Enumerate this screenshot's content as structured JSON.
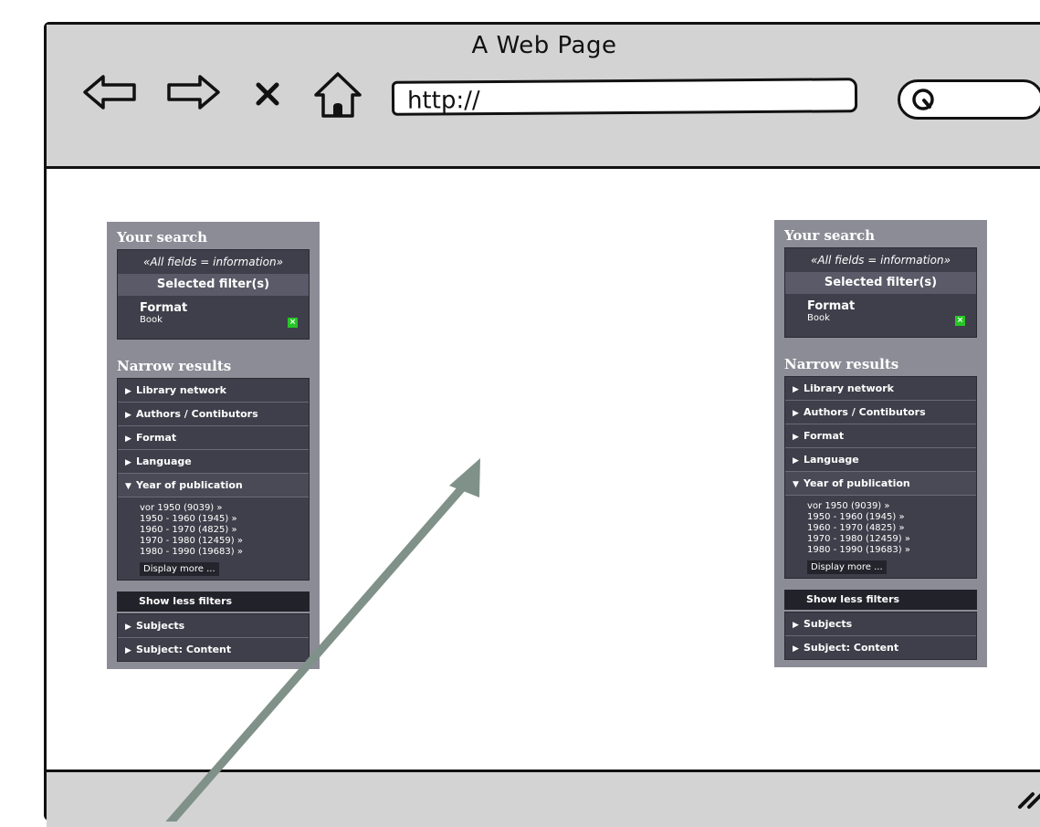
{
  "browser": {
    "title": "A Web Page",
    "url": "http://",
    "back_icon": "back-arrow-icon",
    "forward_icon": "forward-arrow-icon",
    "stop_icon": "close-icon",
    "home_icon": "home-icon",
    "search_icon": "search-icon",
    "resize_icon": "resize-grip-icon"
  },
  "panels": [
    {
      "your_search": "Your search",
      "query": "«All fields = information»",
      "selected_filters": "Selected filter(s)",
      "filter": {
        "name": "Format",
        "value": "Book",
        "remove": "×"
      },
      "narrow_results": "Narrow results",
      "facets": [
        "Library network",
        "Authors / Contibutors",
        "Format",
        "Language"
      ],
      "open_facet": "Year of publication",
      "years": [
        "vor 1950  (9039) »",
        "1950 - 1960  (1945) »",
        "1960 - 1970  (4825) »",
        "1970 - 1980  (12459) »",
        "1980 - 1990  (19683) »"
      ],
      "display_more": "Display more ...",
      "show_less": "Show less filters",
      "more_facets": [
        "Subjects",
        "Subject: Content"
      ]
    },
    {
      "your_search": "Your search",
      "query": "«All fields = information»",
      "selected_filters": "Selected filter(s)",
      "filter": {
        "name": "Format",
        "value": "Book",
        "remove": "×"
      },
      "narrow_results": "Narrow results",
      "facets": [
        "Library network",
        "Authors / Contibutors",
        "Format",
        "Language"
      ],
      "open_facet": "Year of publication",
      "years": [
        "vor 1950  (9039) »",
        "1950 - 1960  (1945) »",
        "1960 - 1970  (4825) »",
        "1970 - 1980  (12459) »",
        "1980 - 1990  (19683) »"
      ],
      "display_more": "Display more ...",
      "show_less": "Show less filters",
      "more_facets": [
        "Subjects",
        "Subject: Content"
      ]
    }
  ],
  "colors": {
    "chrome": "#d3d3d3",
    "panel": "#8c8c97",
    "box": "#3f3f4b",
    "remove_badge": "#26c626",
    "annotation_arrow": "#7f9189"
  }
}
